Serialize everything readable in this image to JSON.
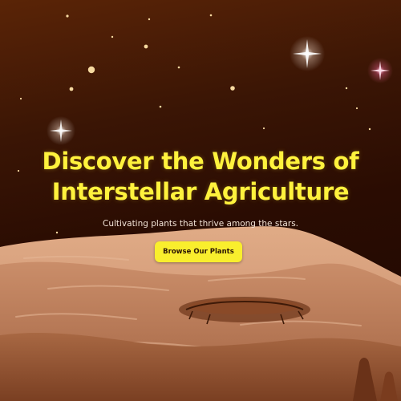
{
  "hero": {
    "title_line1": "Discover the Wonders of",
    "title_line2": "Interstellar Agriculture",
    "subtitle": "Cultivating plants that thrive among the stars.",
    "cta_label": "Browse Our Plants"
  },
  "colors": {
    "title": "#fff23d",
    "button_bg": "#f9ee2d",
    "sky_top": "#5a2406",
    "sky_bottom": "#1e0801",
    "ground_light": "#d6a07c",
    "ground_dark": "#8a4e2c"
  },
  "icons": [
    "sparkle-star-icon",
    "crater-icon"
  ]
}
